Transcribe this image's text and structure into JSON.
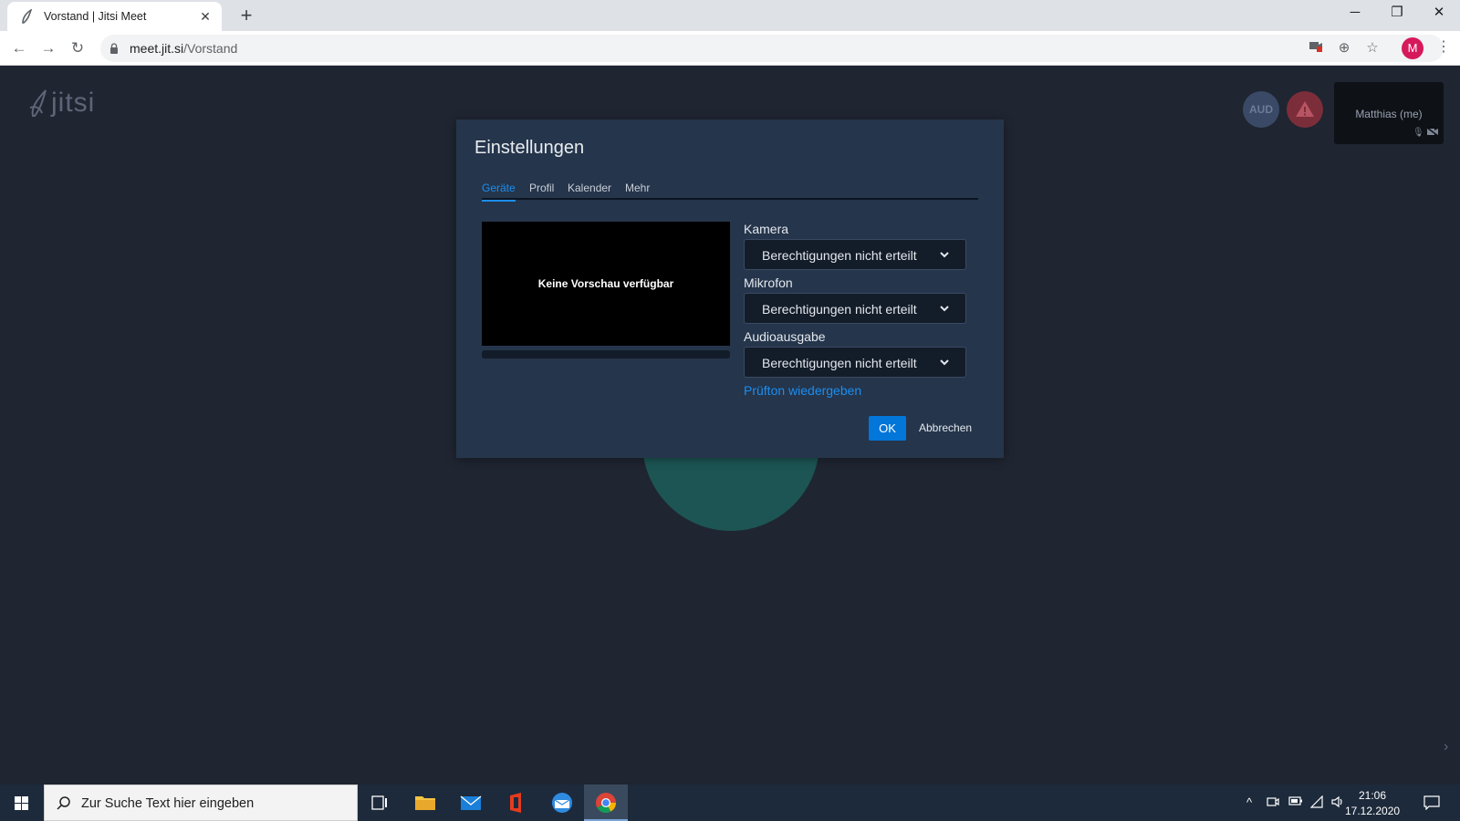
{
  "browser": {
    "tab_title": "Vorstand | Jitsi Meet",
    "new_tab_label": "+",
    "url_host": "meet.jit.si",
    "url_path": "/Vorstand",
    "profile_initial": "M",
    "profile_color": "#d6195a"
  },
  "jitsi": {
    "logo_text": "jitsi",
    "audio_indicator": "AUD",
    "self_name": "Matthias (me)"
  },
  "settings_dialog": {
    "title": "Einstellungen",
    "tabs": [
      {
        "label": "Geräte",
        "active": true
      },
      {
        "label": "Profil",
        "active": false
      },
      {
        "label": "Kalender",
        "active": false
      },
      {
        "label": "Mehr",
        "active": false
      }
    ],
    "preview_message": "Keine Vorschau verfügbar",
    "camera": {
      "label": "Kamera",
      "value": "Berechtigungen nicht erteilt"
    },
    "microphone": {
      "label": "Mikrofon",
      "value": "Berechtigungen nicht erteilt"
    },
    "audio_output": {
      "label": "Audioausgabe",
      "value": "Berechtigungen nicht erteilt"
    },
    "test_sound_link": "Prüfton wiedergeben",
    "ok_label": "OK",
    "cancel_label": "Abbrechen"
  },
  "taskbar": {
    "search_placeholder": "Zur Suche Text hier eingeben",
    "time": "21:06",
    "date": "17.12.2020"
  },
  "colors": {
    "accent": "#1b8ef0",
    "dialog_bg": "#25354b",
    "page_bg": "#1f2531"
  }
}
